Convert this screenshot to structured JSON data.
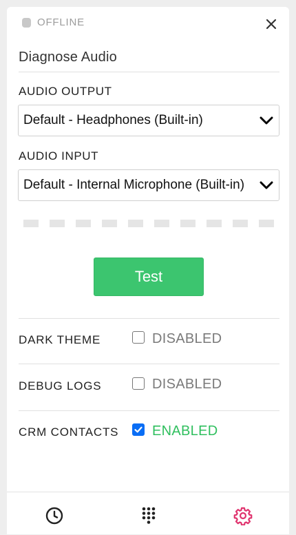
{
  "status": {
    "text": "OFFLINE",
    "dot_color": "#c8c8c8"
  },
  "header": {
    "title": "Diagnose Audio",
    "close_icon": "close-icon"
  },
  "audio_output": {
    "label": "AUDIO OUTPUT",
    "selected": "Default - Headphones (Built-in)"
  },
  "audio_input": {
    "label": "AUDIO INPUT",
    "selected": "Default - Internal Microphone (Built-in)"
  },
  "meter": {
    "level": 0
  },
  "test_button": {
    "label": "Test",
    "color": "#3cc56f"
  },
  "settings": [
    {
      "label": "DARK THEME",
      "checked": false,
      "state": "DISABLED",
      "state_color": "#7a7a7a"
    },
    {
      "label": "DEBUG LOGS",
      "checked": false,
      "state": "DISABLED",
      "state_color": "#7a7a7a"
    },
    {
      "label": "CRM CONTACTS",
      "checked": true,
      "state": "ENABLED",
      "state_color": "#2fbf5e"
    }
  ],
  "footer": {
    "tabs": [
      {
        "icon": "clock-icon",
        "color": "#222222",
        "active": false
      },
      {
        "icon": "dialpad-icon",
        "color": "#222222",
        "active": false
      },
      {
        "icon": "settings-gear-icon",
        "color": "#e0336e",
        "active": true
      }
    ]
  }
}
